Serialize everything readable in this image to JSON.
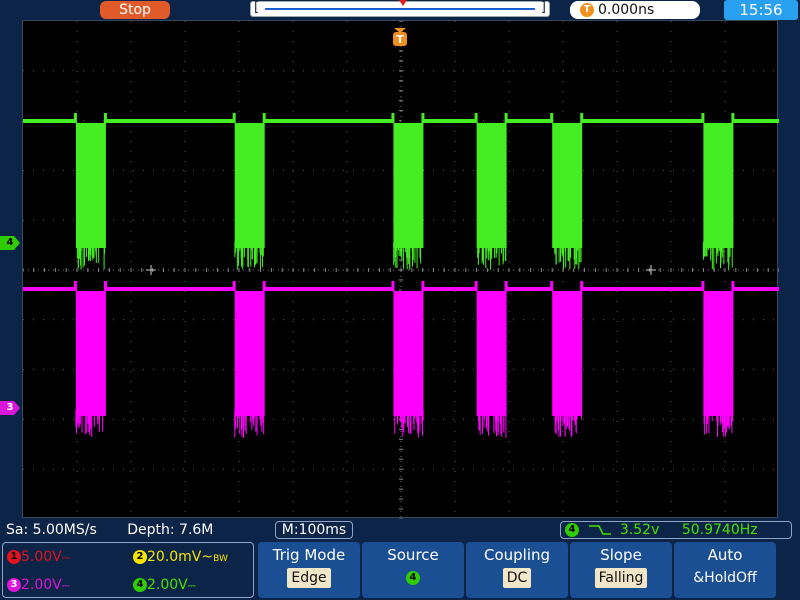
{
  "top": {
    "run_state": "Stop",
    "trigger_position": "0.000ns",
    "clock": "15:56",
    "trigger_icon": "T"
  },
  "markers": {
    "ch4": "4",
    "ch3": "3"
  },
  "status": {
    "sample_rate": "Sa: 5.00MS/s",
    "depth": "Depth: 7.6M",
    "timebase": "M:100ms",
    "trig_channel": "4",
    "trig_level": "3.52v",
    "frequency": "50.9740Hz"
  },
  "channels": [
    {
      "num": "1",
      "scale": "5.00V",
      "coupling": "DC",
      "color": "#e0141e",
      "bw": ""
    },
    {
      "num": "2",
      "scale": "20.0mV",
      "coupling": "AC",
      "color": "#f5e600",
      "bw": "BW"
    },
    {
      "num": "3",
      "scale": "2.00V",
      "coupling": "DC",
      "color": "#d916d9",
      "bw": ""
    },
    {
      "num": "4",
      "scale": "2.00V",
      "coupling": "DC",
      "color": "#2ecc00",
      "bw": ""
    }
  ],
  "softkeys": [
    {
      "title": "Trig Mode",
      "value": "Edge"
    },
    {
      "title": "Source",
      "value": "4"
    },
    {
      "title": "Coupling",
      "value": "DC"
    },
    {
      "title": "Slope",
      "value": "Falling"
    },
    {
      "title": "Auto",
      "value": "&HoldOff"
    }
  ],
  "traces": {
    "ch4_color": "#44ee22",
    "ch3_color": "#ff00ff",
    "bursts": [
      0.07,
      0.28,
      0.49,
      0.6,
      0.7,
      0.9
    ]
  },
  "icons": {
    "trigger_marker": "trigger-t-icon",
    "slope": "falling-edge-icon"
  }
}
